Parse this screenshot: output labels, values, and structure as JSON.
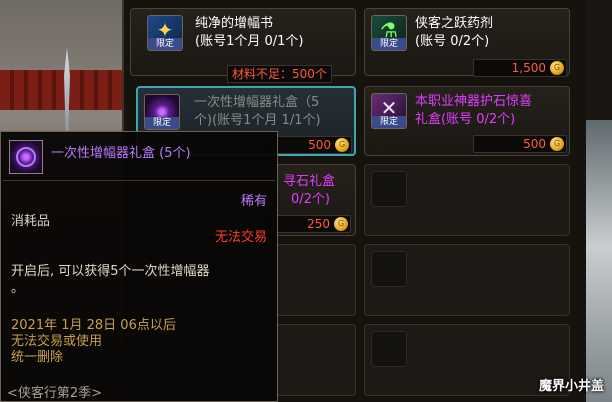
{
  "shop": {
    "items": [
      {
        "name_line1": "纯净的增幅书",
        "name_line2": "(账号1个月 0/1个)",
        "tag": "限定",
        "icon": "book-icon",
        "name_color": "#ffffff",
        "warning": "材料不足：500个"
      },
      {
        "name_line1": "侠客之跃药剂",
        "name_line2": "(账号 0/2个)",
        "tag": "限定",
        "icon": "potion-icon",
        "name_color": "#ffffff",
        "price": "1,500"
      },
      {
        "name_line1": "一次性增幅器礼盒（5",
        "name_line2": "个)(账号1个月 1/1个)",
        "tag": "限定",
        "icon": "amplifier-box-icon",
        "name_color": "#8a8a8a",
        "price": "500",
        "selected": true
      },
      {
        "name_line1": "本职业神器护石惊喜",
        "name_line2": "礼盒(账号 0/2个)",
        "tag": "限定",
        "icon": "talisman-box-icon",
        "name_color": "#e23cff",
        "price": "500"
      },
      {
        "name_line1": "寻石礼盒",
        "name_line2": "0/2个)",
        "icon": "stone-box-icon",
        "name_color": "#e23cff",
        "price": "250"
      }
    ]
  },
  "tooltip": {
    "title": "一次性增幅器礼盒 (5个)",
    "rarity": "稀有",
    "category": "消耗品",
    "trade": "无法交易",
    "desc_line1": "开启后, 可以获得5个一次性增幅器",
    "desc_line2": "。",
    "expiry_line1": "2021年 1月 28日 06点以后",
    "expiry_line2": "无法交易或使用",
    "expiry_line3": "统一删除",
    "footer": "<侠客行第2季>"
  },
  "watermark": "魔界小井盖",
  "colors": {
    "rare": "#b97aff",
    "warning": "#ff5a3a",
    "selected_border": "#3fa7b3"
  }
}
